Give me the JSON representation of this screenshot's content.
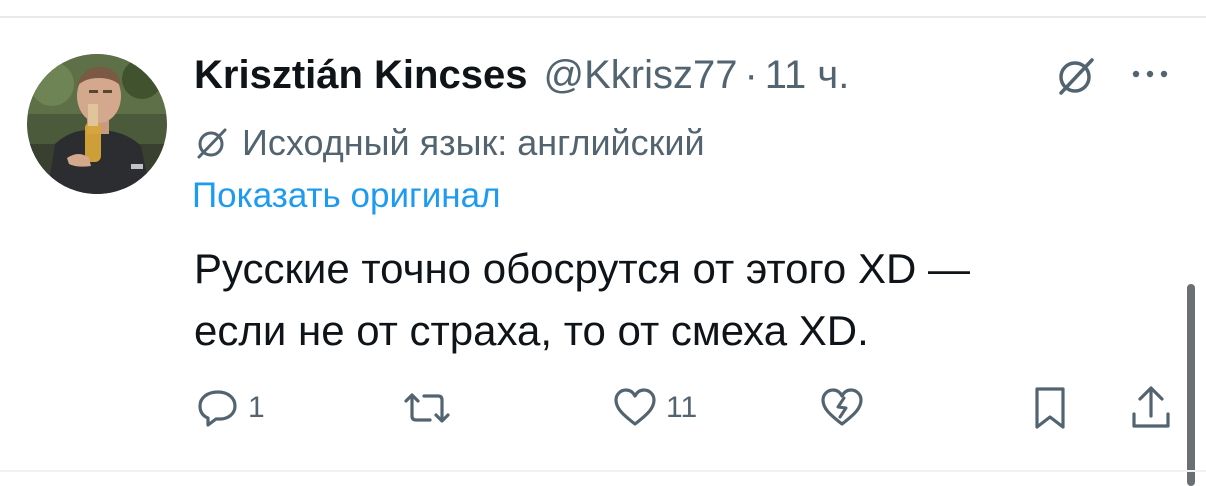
{
  "tweet": {
    "author": {
      "display_name": "Krisztián Kincses",
      "handle": "@Kkrisz77",
      "separator": "·",
      "time": "11 ч."
    },
    "translation": {
      "icon": "grok-icon",
      "label": "Исходный язык: английский",
      "show_original": "Показать оригинал"
    },
    "text_lines": [
      "Русские точно обосрутся от этого XD —",
      "если не от страха, то от смеха XD."
    ],
    "actions": {
      "reply": {
        "icon": "reply-icon",
        "count": "1"
      },
      "retweet": {
        "icon": "retweet-icon",
        "count": ""
      },
      "like": {
        "icon": "heart-icon",
        "count": "11"
      },
      "dislike": {
        "icon": "broken-heart-icon"
      },
      "bookmark": {
        "icon": "bookmark-icon"
      },
      "share": {
        "icon": "share-icon"
      }
    },
    "top_icons": [
      "grok-icon",
      "more-icon"
    ]
  },
  "colors": {
    "text": "#0f1419",
    "secondary": "#536471",
    "link": "#1d9bf0",
    "divider": "#e7e9ea"
  }
}
